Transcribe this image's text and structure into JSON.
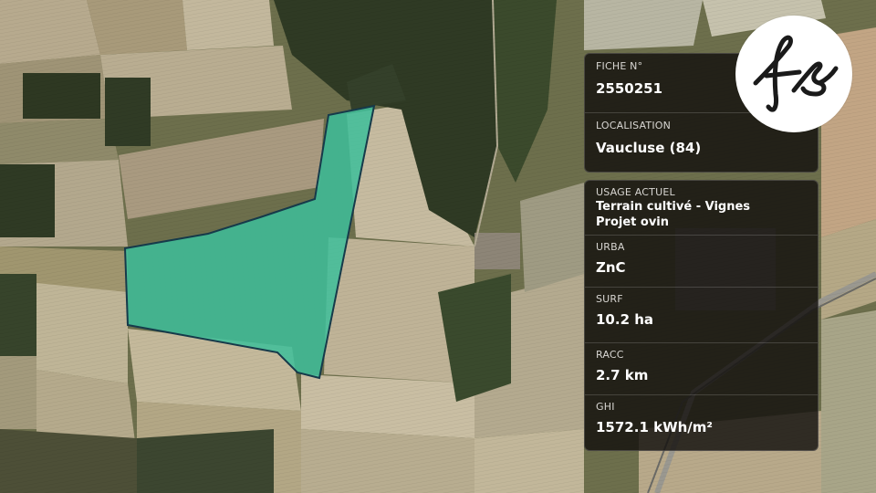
{
  "colors": {
    "parcel_fill": "#3dbe9a",
    "parcel_stroke": "#163a4a",
    "panel_bg": "#12100e",
    "logo_bg": "#ffffff",
    "logo_ink": "#1a1a1a"
  },
  "icons": {
    "logo": "fs-monogram-logo"
  },
  "fiche": {
    "label": "FICHE N°",
    "value": "2550251"
  },
  "localisation": {
    "label": "LOCALISATION",
    "value": "Vaucluse (84)"
  },
  "usage": {
    "label": "USAGE ACTUEL",
    "line1": "Terrain cultivé - Vignes",
    "line2": "Projet ovin"
  },
  "urba": {
    "label": "URBA",
    "value": "ZnC"
  },
  "surf": {
    "label": "SURF",
    "value": "10.2 ha"
  },
  "racc": {
    "label": "RACC",
    "value": "2.7 km"
  },
  "ghi": {
    "label": "GHI",
    "value": "1572.1 kWh/m²"
  }
}
